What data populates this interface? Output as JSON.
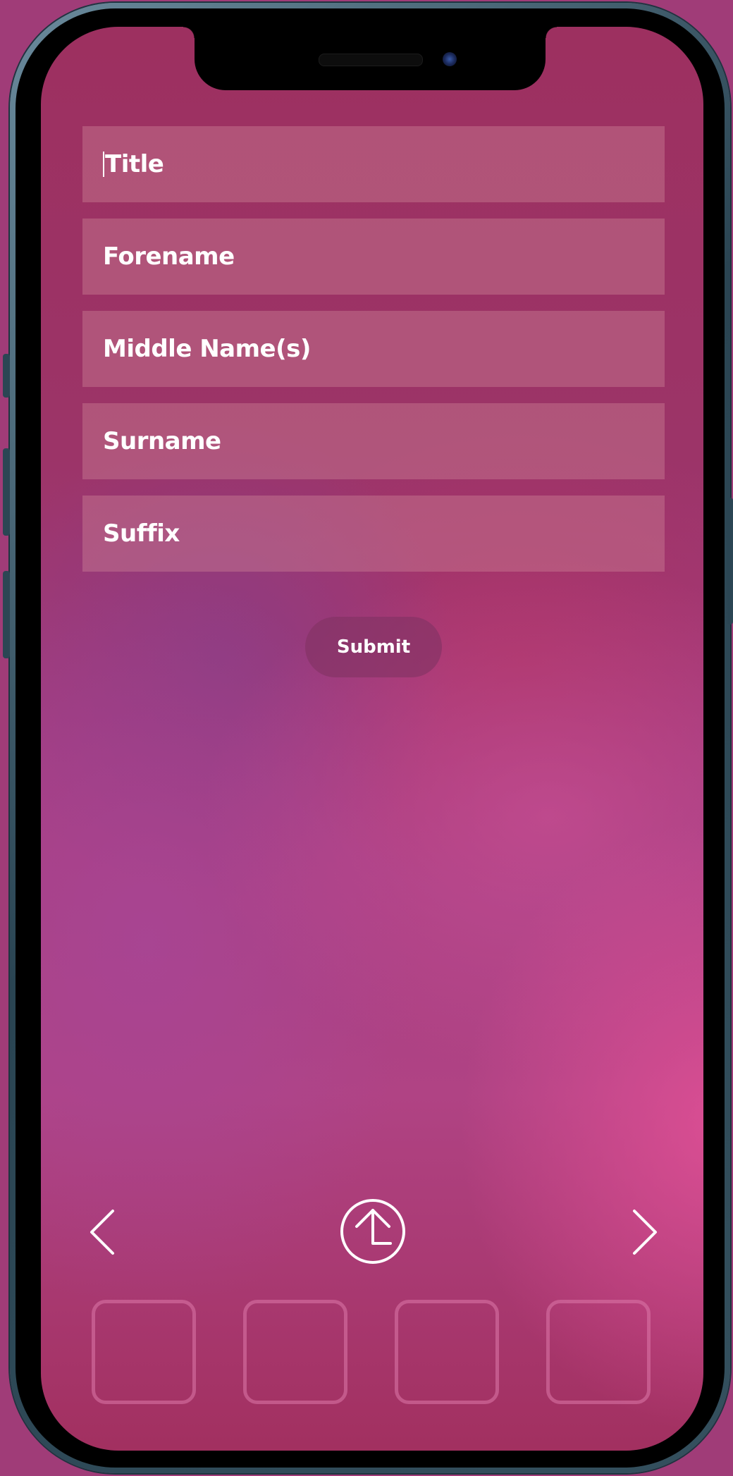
{
  "form": {
    "title_placeholder": "Title",
    "forename_placeholder": "Forename",
    "middle_names_placeholder": "Middle Name(s)",
    "surname_placeholder": "Surname",
    "suffix_placeholder": "Suffix",
    "submit_label": "Submit"
  },
  "navigation": {
    "back_icon": "chevron-left-icon",
    "upload_icon": "upload-icon",
    "forward_icon": "chevron-right-icon"
  },
  "thumbnails": {
    "count_visible": 4
  },
  "colors": {
    "text": "#ffffff",
    "frame": "#2a4452"
  }
}
